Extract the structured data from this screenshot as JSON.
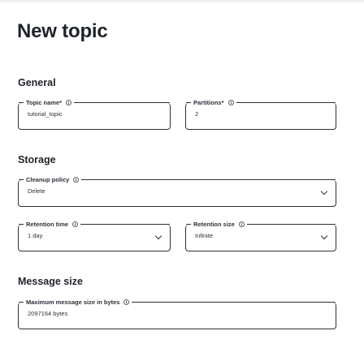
{
  "page_title": "New topic",
  "sections": {
    "general": "General",
    "storage": "Storage",
    "message_size": "Message size"
  },
  "fields": {
    "topic_name": {
      "label": "Topic name*",
      "value": "tutorial_topic"
    },
    "partitions": {
      "label": "Partitions*",
      "value": "2"
    },
    "cleanup_policy": {
      "label": "Cleanup policy",
      "value": "Delete"
    },
    "retention_time": {
      "label": "Retention time",
      "value": "1 day"
    },
    "retention_size": {
      "label": "Retention size",
      "value": "Infinite"
    },
    "max_message_size": {
      "label": "Maximum message size in bytes",
      "value": "2097164 bytes"
    }
  },
  "icons": [
    "info-icon",
    "chevron-down-icon"
  ]
}
